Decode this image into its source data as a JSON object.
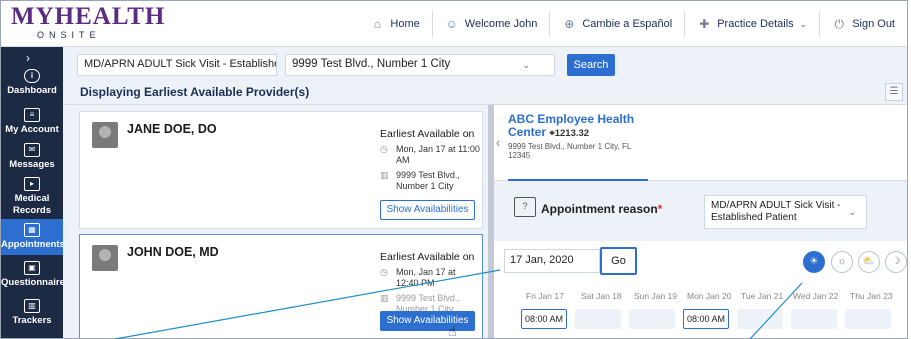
{
  "logo": {
    "main": "MYHEALTH",
    "sub": "ONSITE"
  },
  "nav": [
    {
      "icon": "home-icon",
      "glyph": "⌂",
      "label": "Home"
    },
    {
      "icon": "user-icon",
      "glyph": "☺",
      "label": "Welcome John"
    },
    {
      "icon": "globe-icon",
      "glyph": "⊕",
      "label": "Cambie a Español"
    },
    {
      "icon": "medical-cross-icon",
      "glyph": "✚",
      "label": "Practice Details",
      "caret": "⌄"
    },
    {
      "icon": "power-icon",
      "glyph": "⏻",
      "label": "Sign Out"
    }
  ],
  "sidebar": {
    "items": [
      {
        "label": "Dashboard",
        "glyph": "i"
      },
      {
        "label": "My Account",
        "glyph": "≡"
      },
      {
        "label": "Messages",
        "glyph": "✉"
      },
      {
        "label": "Medical Records",
        "glyph": "▸"
      },
      {
        "label": "Appointments",
        "glyph": "▦"
      },
      {
        "label": "Questionnaires",
        "glyph": "▣"
      },
      {
        "label": "Trackers",
        "glyph": "▥"
      }
    ],
    "active": "Appointments"
  },
  "filters": {
    "visit_type": "MD/APRN ADULT Sick Visit - Establishe...",
    "location": "9999 Test Blvd., Number 1 City",
    "search_label": "Search"
  },
  "title": "Displaying Earliest Available Provider(s)",
  "providers": [
    {
      "name": "JANE DOE, DO",
      "earliest_label": "Earliest Available on",
      "datetime": "Mon, Jan 17 at 11:00 AM",
      "address": "9999 Test Blvd., Number 1 City",
      "button": "Show Availabilities"
    },
    {
      "name": "JOHN DOE, MD",
      "earliest_label": "Earliest Available on",
      "datetime": "Mon, Jan 17 at 12:40 PM",
      "address": "9999 Test Blvd., Number 1 City",
      "button": "Show Availabilities"
    }
  ],
  "location_card": {
    "name": "ABC Employee Health Center",
    "distance": "1213.32",
    "address": "9999 Test Blvd., Number 1 City, FL 12345"
  },
  "reason": {
    "label": "Appointment reason",
    "required_mark": "*",
    "value": "MD/APRN ADULT Sick Visit - Established Patient"
  },
  "date": {
    "value": "17 Jan, 2020",
    "go_label": "Go"
  },
  "time_filters": [
    {
      "icon": "all-day-icon",
      "glyph": "☀",
      "active": true
    },
    {
      "icon": "morning-icon",
      "glyph": "☼",
      "active": false
    },
    {
      "icon": "afternoon-icon",
      "glyph": "⛅",
      "active": false
    },
    {
      "icon": "evening-icon",
      "glyph": "☽",
      "active": false
    }
  ],
  "days": [
    "Fri Jan 17",
    "Sat Jan 18",
    "Sun Jan 19",
    "Mon Jan 20",
    "Tue Jan 21",
    "Wed Jan 22",
    "Thu Jan 23"
  ],
  "slots": [
    "08:00 AM",
    "",
    "",
    "08:00 AM",
    "",
    "",
    ""
  ],
  "colors": {
    "brand_purple": "#5b2d82",
    "navy": "#1d2a44",
    "accent_blue": "#2d6fd0",
    "panel_bg": "#edf2f8"
  }
}
